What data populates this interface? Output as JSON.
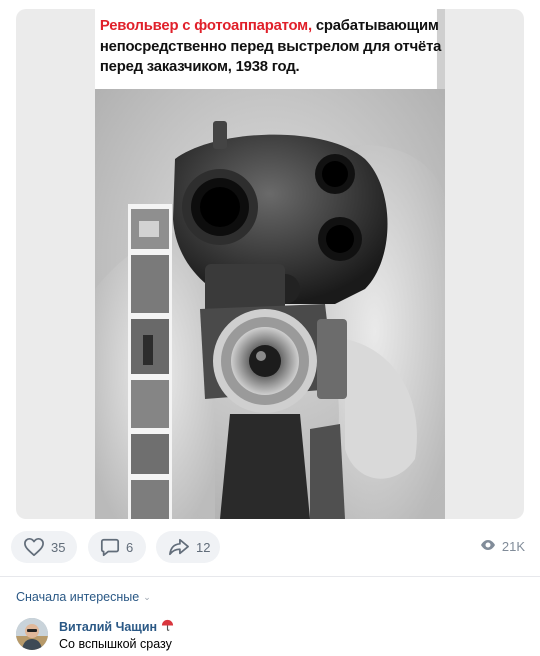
{
  "post": {
    "caption_red": "Револьвер с фотоаппаратом,",
    "caption_rest_line1": " срабатывающим",
    "caption_line2": "непосредственно перед выстрелом для отчёта",
    "caption_line3": "перед заказчиком, 1938 год."
  },
  "actions": {
    "likes": "35",
    "comments": "6",
    "shares": "12",
    "views": "21K"
  },
  "comments_section": {
    "sort_label": "Сначала интересные",
    "items": [
      {
        "author": "Виталий Чащин",
        "author_badge": "umbrella-icon",
        "text": "Со вспышкой сразу"
      }
    ]
  },
  "colors": {
    "accent_link": "#2a5885",
    "caption_red": "#e0202a",
    "pill_bg": "#f0f2f5",
    "icon_gray": "#626d7a"
  }
}
